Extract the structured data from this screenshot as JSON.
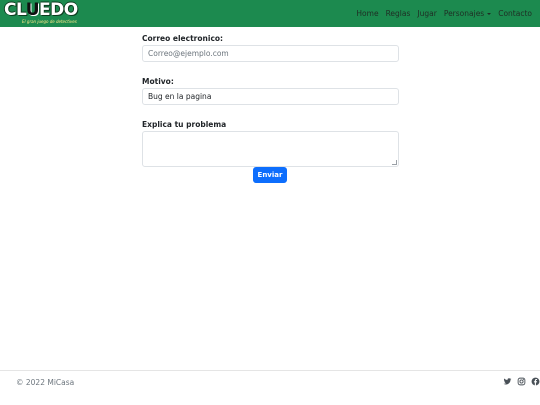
{
  "brand": {
    "word_pre": "CL",
    "word_u": "U",
    "word_post": "EDO",
    "tagline": "El gran juego de detectives"
  },
  "nav": {
    "items": [
      {
        "label": "Home"
      },
      {
        "label": "Reglas"
      },
      {
        "label": "Jugar"
      },
      {
        "label": "Personajes"
      },
      {
        "label": "Contacto"
      }
    ]
  },
  "form": {
    "email_label": "Correo electronico:",
    "email_placeholder": "Correo@ejemplo.com",
    "motivo_label": "Motivo:",
    "motivo_value": "Bug en la pagina",
    "problema_label": "Explica tu problema",
    "problema_value": "",
    "submit_label": "Enviar"
  },
  "footer": {
    "copyright": "© 2022 MiCasa",
    "social_icons": [
      "twitter-icon",
      "instagram-icon",
      "facebook-icon"
    ]
  },
  "colors": {
    "navbar": "#1c8a4f",
    "primary_button": "#0d6efd"
  }
}
